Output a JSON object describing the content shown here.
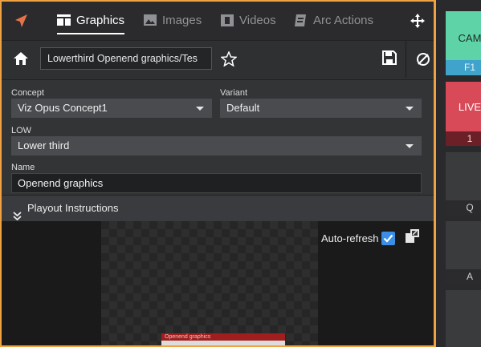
{
  "tabs": [
    {
      "label": "Graphics",
      "icon": "graphics-icon",
      "active": true
    },
    {
      "label": "Images",
      "icon": "images-icon",
      "active": false
    },
    {
      "label": "Videos",
      "icon": "videos-icon",
      "active": false
    },
    {
      "label": "Arc Actions",
      "icon": "arc-actions-icon",
      "active": false
    }
  ],
  "path": {
    "value": "Lowerthird Openend graphics/Tes"
  },
  "form": {
    "concept_label": "Concept",
    "concept_value": "Viz Opus Concept1",
    "variant_label": "Variant",
    "variant_value": "Default",
    "low_label": "LOW",
    "low_value": "Lower third",
    "name_label": "Name",
    "name_value": "Openend graphics"
  },
  "playout": {
    "label": "Playout Instructions"
  },
  "preview": {
    "autorefresh_label": "Auto-refresh",
    "autorefresh_checked": true,
    "lowerthird_text": "Openend graphics"
  },
  "right_tiles": [
    {
      "label": "CAM",
      "sub": "F1",
      "color": "#5fd3a8",
      "subcolor": "#3fa3cc"
    },
    {
      "label": "LIVE",
      "sub": "1",
      "color": "#d84a57",
      "subcolor": "#6b2028"
    },
    {
      "label": "",
      "sub": "Q",
      "color": "#3a3b3d",
      "subcolor": "#2b2b2d"
    },
    {
      "label": "",
      "sub": "A",
      "color": "#3a3b3d",
      "subcolor": "#2b2b2d"
    },
    {
      "label": "",
      "sub": "",
      "color": "#3a3b3d",
      "subcolor": "#2b2b2d"
    }
  ],
  "colors": {
    "accent": "#f0a243",
    "check": "#3a8ee6"
  }
}
